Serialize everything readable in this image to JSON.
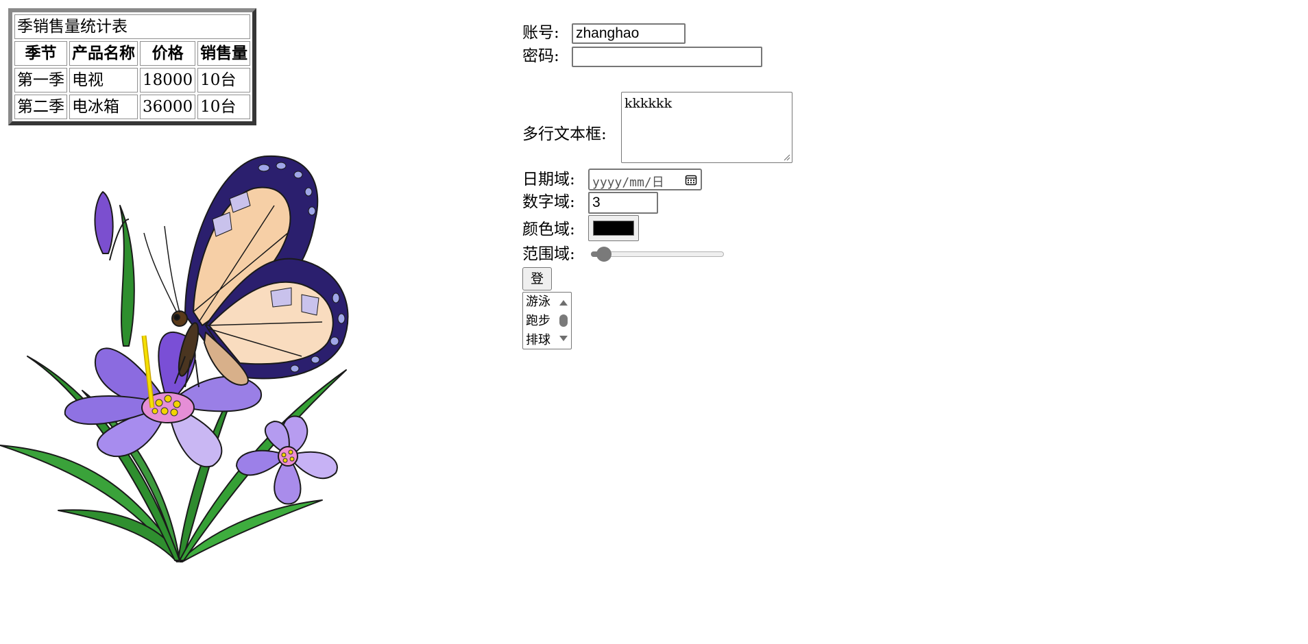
{
  "table": {
    "caption": "季销售量统计表",
    "headers": [
      "季节",
      "产品名称",
      "价格",
      "销售量"
    ],
    "rows": [
      [
        "第一季",
        "电视",
        "18000",
        "10台"
      ],
      [
        "第二季",
        "电冰箱",
        "36000",
        "10台"
      ]
    ]
  },
  "illustration": {
    "icon": "butterfly-on-flower-illustration"
  },
  "form": {
    "account_label": "账号:",
    "account_value": "zhanghao",
    "password_label": "密码:",
    "password_value": "",
    "textarea_label": "多行文本框:",
    "textarea_value": "kkkkkk",
    "date_label": "日期域:",
    "date_placeholder": "yyyy/mm/日",
    "number_label": "数字域:",
    "number_value": "3",
    "color_label": "颜色域:",
    "color_value": "#000000",
    "range_label": "范围域:",
    "range_value": 0.1,
    "submit_label": "登陆",
    "list_options": [
      "游泳",
      "跑步",
      "排球"
    ]
  }
}
